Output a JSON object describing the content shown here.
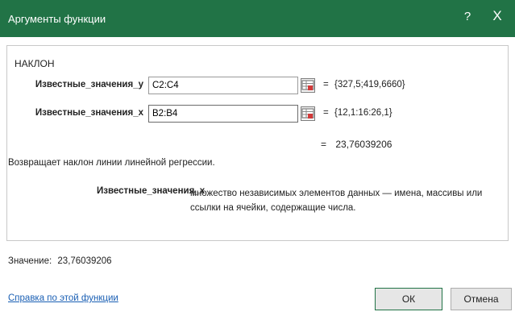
{
  "window": {
    "title": "Аргументы функции",
    "help_glyph": "?",
    "close_glyph": "X",
    "accent": "#217346"
  },
  "function_name": "НАКЛОН",
  "arguments": [
    {
      "label": "Известные_значения_y",
      "value": "C2:C4",
      "result_eq": "=",
      "result": "{327,5;419,6660}"
    },
    {
      "label": "Известные_значения_x",
      "value": "B2:B4",
      "result_eq": "=",
      "result": "{12,1:16:26,1}"
    }
  ],
  "formula_result": {
    "eq": "=",
    "value": "23,76039206"
  },
  "description": "Возвращает наклон линии линейной регрессии.",
  "parameter_help": {
    "name": "Известные_значения_x",
    "text": "множество независимых элементов данных — имена, массивы или ссылки на ячейки, содержащие числа."
  },
  "value_line": {
    "label": "Значение:",
    "value": "23,76039206"
  },
  "help_link": "Справка по этой функции",
  "buttons": {
    "ok": "ОК",
    "cancel": "Отмена"
  }
}
